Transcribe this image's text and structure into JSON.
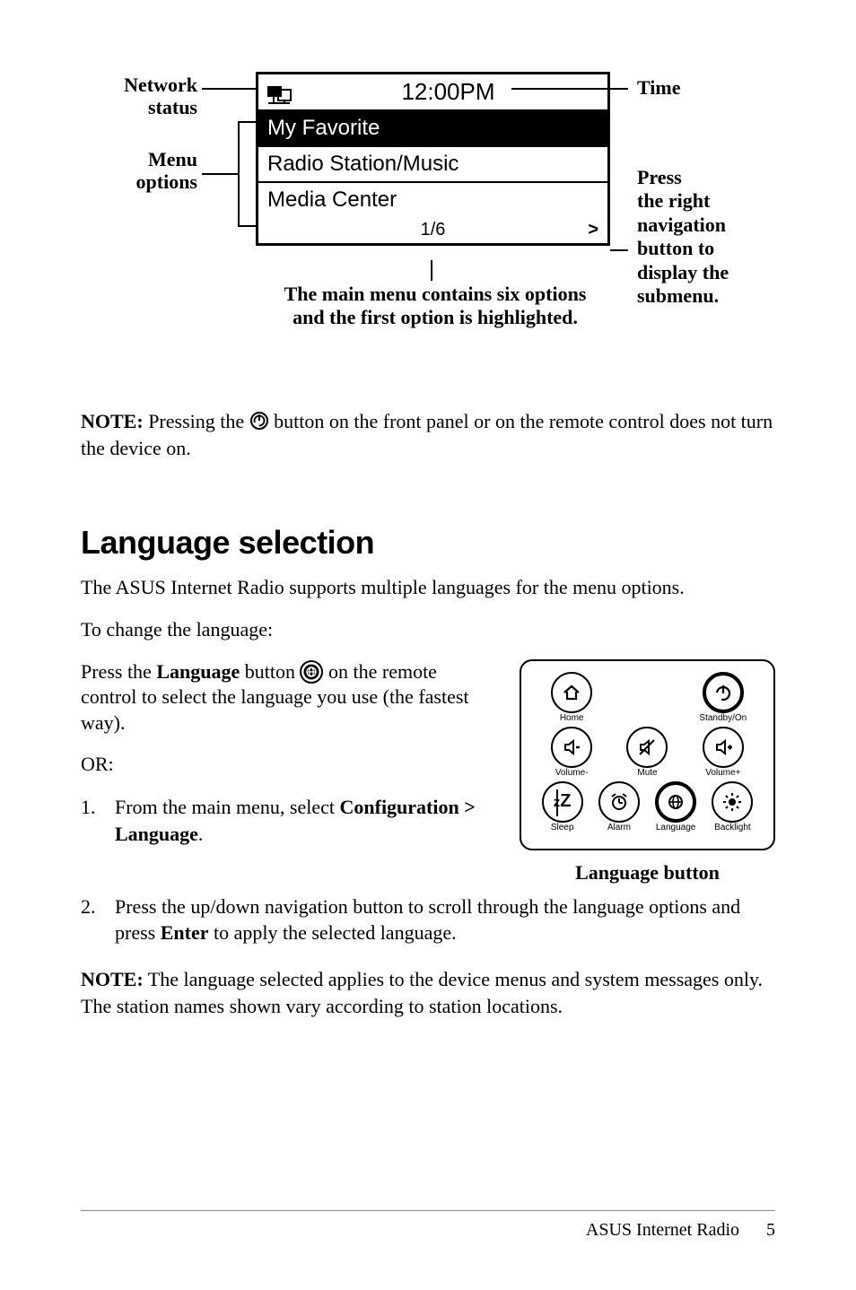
{
  "diagram": {
    "label_network_status": "Network\nstatus",
    "label_menu_options": "Menu\noptions",
    "label_time": "Time",
    "label_press_right": "Press\nthe right\nnavigation\nbutton to\ndisplay the\nsubmenu.",
    "time_display": "12:00PM",
    "rows": [
      "My Favorite",
      "Radio Station/Music",
      "Media Center"
    ],
    "page_indicator": "1/6",
    "arrow": ">",
    "caption": "The main menu contains six options and the first option is highlighted."
  },
  "note1": {
    "prefix": "NOTE:",
    "rest": " Pressing the ",
    "after_icon": " button on the front panel or on the remote control does not turn the device on."
  },
  "section_title": "Language selection",
  "para1": "The ASUS Internet Radio supports multiple languages for the menu options.",
  "para2": "To change the language:",
  "press_lang": {
    "t1": "Press the ",
    "btn": "Language",
    "t2": " button ",
    "t3": " on the remote control to select the language you use (the fastest way)."
  },
  "or_text": "OR:",
  "step1": {
    "t1": "From the main menu, select ",
    "bold": "Configuration > Language",
    "t2": "."
  },
  "step2": {
    "t1": "Press the up/down navigation button to scroll through the language options and press ",
    "bold": "Enter",
    "t2": " to apply the selected language."
  },
  "remote": {
    "labels": [
      "Home",
      "Standby/On",
      "Volume-",
      "Mute",
      "Volume+",
      "Sleep",
      "Alarm",
      "Language",
      "Backlight"
    ],
    "home_glyph": "⌂",
    "caption": "Language button"
  },
  "note2": {
    "prefix": "NOTE:",
    "rest": " The language selected applies to the device menus and system messages only. The station names shown vary according to station locations."
  },
  "footer_product": "ASUS Internet Radio",
  "footer_page": "5"
}
